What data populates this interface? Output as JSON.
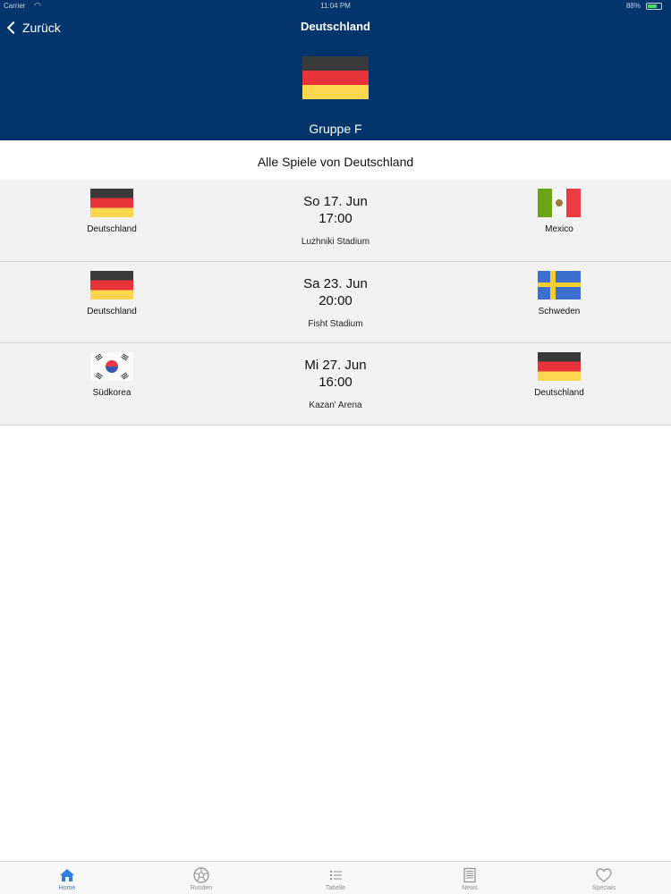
{
  "status_bar": {
    "carrier": "Carrier",
    "time": "11:04 PM",
    "battery": "88%"
  },
  "nav": {
    "back_label": "Zurück",
    "title": "Deutschland"
  },
  "header": {
    "flag": "germany-flag",
    "group": "Gruppe F"
  },
  "section_title": "Alle Spiele von Deutschland",
  "matches": [
    {
      "home": "Deutschland",
      "home_flag": "germany-flag",
      "date": "So 17. Jun",
      "time": "17:00",
      "venue": "Luzhniki Stadium",
      "away": "Mexico",
      "away_flag": "mexico-flag"
    },
    {
      "home": "Deutschland",
      "home_flag": "germany-flag",
      "date": "Sa 23. Jun",
      "time": "20:00",
      "venue": "Fisht Stadium",
      "away": "Schweden",
      "away_flag": "sweden-flag"
    },
    {
      "home": "Südkorea",
      "home_flag": "south-korea-flag",
      "date": "Mi 27. Jun",
      "time": "16:00",
      "venue": "Kazan' Arena",
      "away": "Deutschland",
      "away_flag": "germany-flag"
    }
  ],
  "tabbar": {
    "items": [
      {
        "label": "Home",
        "icon": "home-icon",
        "active": true
      },
      {
        "label": "Runden",
        "icon": "soccer-ball-icon",
        "active": false
      },
      {
        "label": "Tabelle",
        "icon": "list-icon",
        "active": false
      },
      {
        "label": "News",
        "icon": "newspaper-icon",
        "active": false
      },
      {
        "label": "Specials",
        "icon": "heart-icon",
        "active": false
      }
    ]
  },
  "colors": {
    "header_bg": "#03346b",
    "row_bg": "#f2f2f3",
    "active_tab": "#2f7de1"
  }
}
